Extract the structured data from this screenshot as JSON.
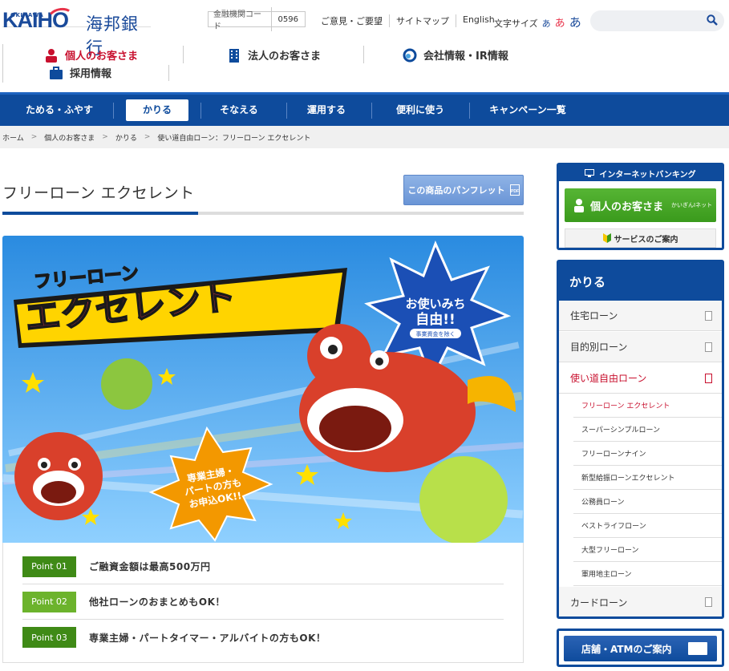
{
  "header": {
    "logo_sub": "OKINAWA",
    "logo_main": "KAIHO",
    "logo_jp": "海邦銀行",
    "bank_code_label": "金融機関コード",
    "bank_code_value": "0596",
    "links": [
      "ご意見・ご要望",
      "サイトマップ",
      "English"
    ],
    "font_size_label": "文字サイズ",
    "font_sizes": [
      "あ",
      "あ",
      "あ"
    ],
    "search_placeholder": ""
  },
  "segments": {
    "personal": "個人のお客さま",
    "corporate": "法人のお客さま",
    "company": "会社情報・IR情報",
    "recruit": "採用情報"
  },
  "mainnav": [
    "ためる・ふやす",
    "かりる",
    "そなえる",
    "運用する",
    "便利に使う",
    "キャンペーン一覧"
  ],
  "breadcrumb": [
    "ホーム",
    "個人のお客さま",
    "かりる",
    "使い道自由ローン：フリーローン エクセレント"
  ],
  "page": {
    "title": "フリーローン エクセレント",
    "pamphlet_button": "この商品のパンフレット",
    "pdf_label": "PDF"
  },
  "banner": {
    "title_small": "フリーローン",
    "title_big": "エクセレント",
    "star_text": [
      "お使いみち",
      "自由!!"
    ],
    "star_note": "事業資金を除く",
    "promo": [
      "専業主婦・",
      "パートの方も",
      "お申込OK!!"
    ]
  },
  "points": [
    {
      "tag": "Point 01",
      "text": "ご融資金額は最高500万円",
      "color": "#3f8a16"
    },
    {
      "tag": "Point 02",
      "text": "他社ローンのおまとめもOK！",
      "color": "#6cb32c"
    },
    {
      "tag": "Point 03",
      "text": "専業主婦・パートタイマー・アルバイトの方もOK！",
      "color": "#3f8a16"
    }
  ],
  "internet_banking": {
    "header": "インターネットバンキング",
    "login_label": "個人のお客さま",
    "login_sub": "かいぎんIネット",
    "guide": "サービスのご案内"
  },
  "sidebar": {
    "header": "かりる",
    "items": [
      {
        "label": "住宅ローン",
        "active": false
      },
      {
        "label": "目的別ローン",
        "active": false
      },
      {
        "label": "使い道自由ローン",
        "active": true
      }
    ],
    "subitems": [
      {
        "label": "フリーローン エクセレント",
        "active": true
      },
      {
        "label": "スーパーシンプルローン",
        "active": false
      },
      {
        "label": "フリーローンナイン",
        "active": false
      },
      {
        "label": "新型給振ローンエクセレント",
        "active": false
      },
      {
        "label": "公務員ローン",
        "active": false
      },
      {
        "label": "ベストライフローン",
        "active": false
      },
      {
        "label": "大型フリーローン",
        "active": false
      },
      {
        "label": "軍用地主ローン",
        "active": false
      }
    ],
    "last_item": "カードローン"
  },
  "atm_button": "店舗・ATMのご案内"
}
